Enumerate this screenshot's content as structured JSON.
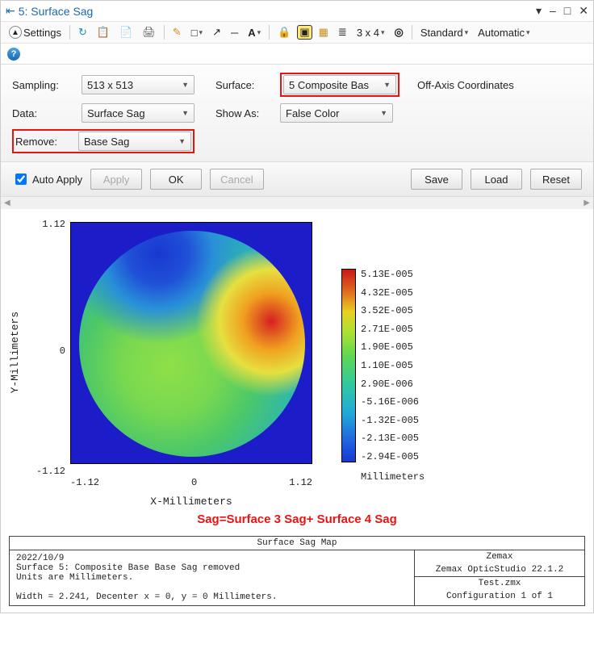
{
  "title": "5: Surface Sag",
  "toolbar": {
    "settings": "Settings",
    "grid": "3 x 4",
    "standard": "Standard",
    "automatic": "Automatic"
  },
  "settings": {
    "sampling_label": "Sampling:",
    "sampling_value": "513 x 513",
    "surface_label": "Surface:",
    "surface_value": "5 Composite Bas",
    "offaxis_label": "Off-Axis Coordinates",
    "data_label": "Data:",
    "data_value": "Surface Sag",
    "showas_label": "Show As:",
    "showas_value": "False Color",
    "remove_label": "Remove:",
    "remove_value": "Base Sag"
  },
  "buttons": {
    "auto_apply": "Auto Apply",
    "apply": "Apply",
    "ok": "OK",
    "cancel": "Cancel",
    "save": "Save",
    "load": "Load",
    "reset": "Reset"
  },
  "chart_data": {
    "type": "heatmap",
    "xlabel": "X-Millimeters",
    "ylabel": "Y-Millimeters",
    "xlim": [
      -1.12,
      1.12
    ],
    "ylim": [
      -1.12,
      1.12
    ],
    "xticks": [
      -1.12,
      0,
      1.12
    ],
    "yticks": [
      -1.12,
      0,
      1.12
    ],
    "colorbar_unit": "Millimeters",
    "colorbar_ticks": [
      "5.13E-005",
      "4.32E-005",
      "3.52E-005",
      "2.71E-005",
      "1.90E-005",
      "1.10E-005",
      "2.90E-006",
      "-5.16E-006",
      "-1.32E-005",
      "-2.13E-005",
      "-2.94E-005"
    ],
    "annotation": "Sag=Surface 3 Sag+ Surface 4 Sag"
  },
  "footer": {
    "title": "Surface Sag Map",
    "left_lines": [
      "2022/10/9",
      "Surface 5: Composite Base Base Sag removed",
      "Units are Millimeters.",
      "",
      "Width = 2.241, Decenter x = 0, y = 0 Millimeters."
    ],
    "right_top1": "Zemax",
    "right_top2": "Zemax OpticStudio 22.1.2",
    "right_bot1": "Test.zmx",
    "right_bot2": "Configuration 1 of 1"
  }
}
